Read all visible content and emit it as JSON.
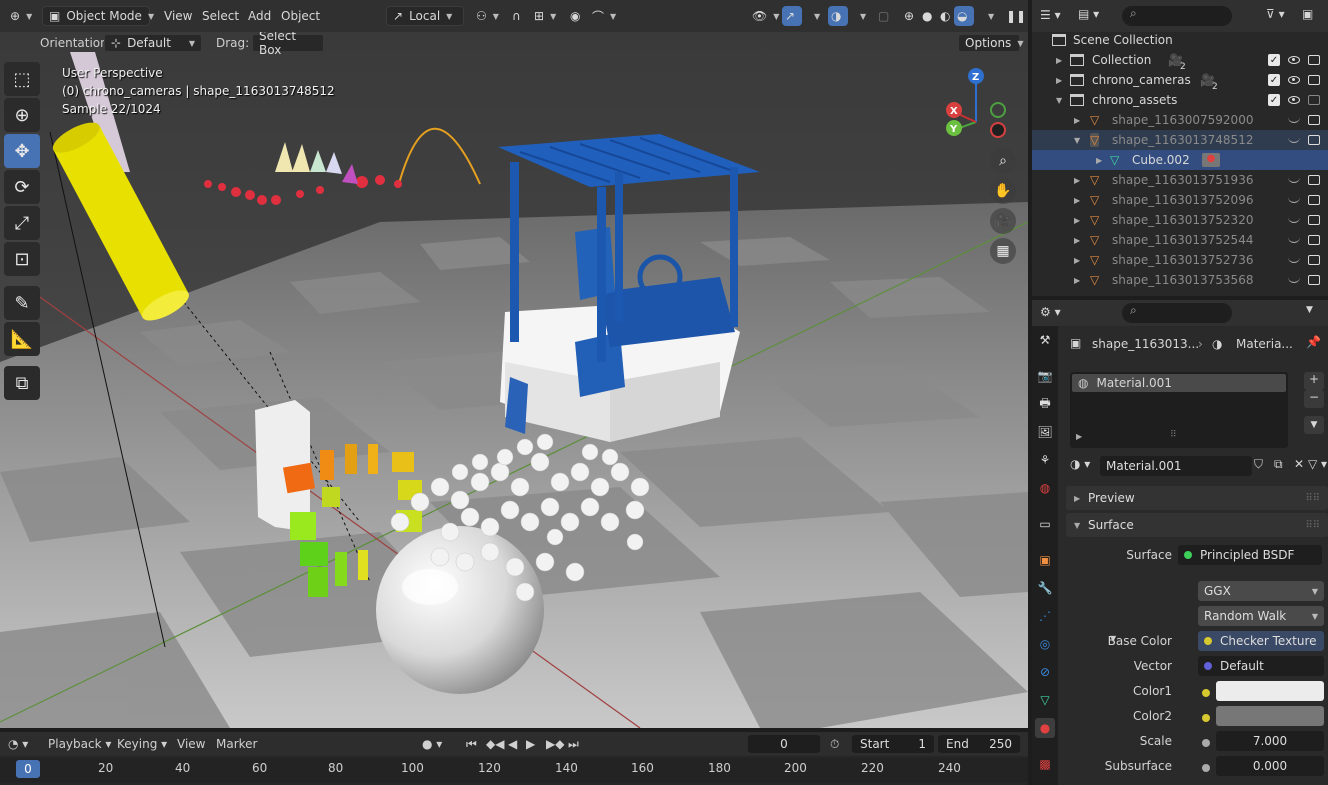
{
  "header": {
    "mode_label": "Object Mode",
    "menus": [
      "View",
      "Select",
      "Add",
      "Object"
    ],
    "transform_orientation": "Local"
  },
  "viewport_subheader": {
    "orientation_label": "Orientation:",
    "orientation_value": "Default",
    "drag_label": "Drag:",
    "drag_value": "Select Box",
    "options_label": "Options"
  },
  "viewport_overlay": {
    "line1": "User Perspective",
    "line2": "(0) chrono_cameras | shape_1163013748512",
    "line3": "Sample 22/1024"
  },
  "gizmo": {
    "x": "X",
    "y": "Y",
    "z": "Z"
  },
  "timeline": {
    "playback": "Playback",
    "keying": "Keying",
    "view": "View",
    "marker": "Marker",
    "current_frame": "0",
    "start_label": "Start",
    "start_value": "1",
    "end_label": "End",
    "end_value": "250",
    "ruler": [
      "0",
      "20",
      "40",
      "60",
      "80",
      "100",
      "120",
      "140",
      "160",
      "180",
      "200",
      "220",
      "240"
    ]
  },
  "outliner": {
    "rows": [
      {
        "label": "Scene Collection"
      },
      {
        "label": "Collection",
        "badge": "2"
      },
      {
        "label": "chrono_cameras",
        "badge": "2"
      },
      {
        "label": "chrono_assets"
      },
      {
        "label": "shape_1163007592000"
      },
      {
        "label": "shape_1163013748512"
      },
      {
        "label": "Cube.002"
      },
      {
        "label": "shape_1163013751936"
      },
      {
        "label": "shape_1163013752096"
      },
      {
        "label": "shape_1163013752320"
      },
      {
        "label": "shape_1163013752544"
      },
      {
        "label": "shape_1163013752736"
      },
      {
        "label": "shape_1163013753568"
      }
    ]
  },
  "properties": {
    "breadcrumb_object": "shape_1163013...",
    "breadcrumb_material": "Materia...",
    "slot": "Material.001",
    "material_name": "Material.001",
    "panel_preview": "Preview",
    "panel_surface": "Surface",
    "surface_label": "Surface",
    "surface_value": "Principled BSDF",
    "distribution": "GGX",
    "subsurface_method": "Random Walk",
    "base_color_label": "Base Color",
    "base_color_value": "Checker Texture",
    "vector_label": "Vector",
    "vector_value": "Default",
    "color1_label": "Color1",
    "color2_label": "Color2",
    "scale_label": "Scale",
    "scale_value": "7.000",
    "subsurface_label": "Subsurface",
    "subsurface_value": "0.000",
    "colors": {
      "color1": "#ececec",
      "color2": "#777777"
    }
  }
}
